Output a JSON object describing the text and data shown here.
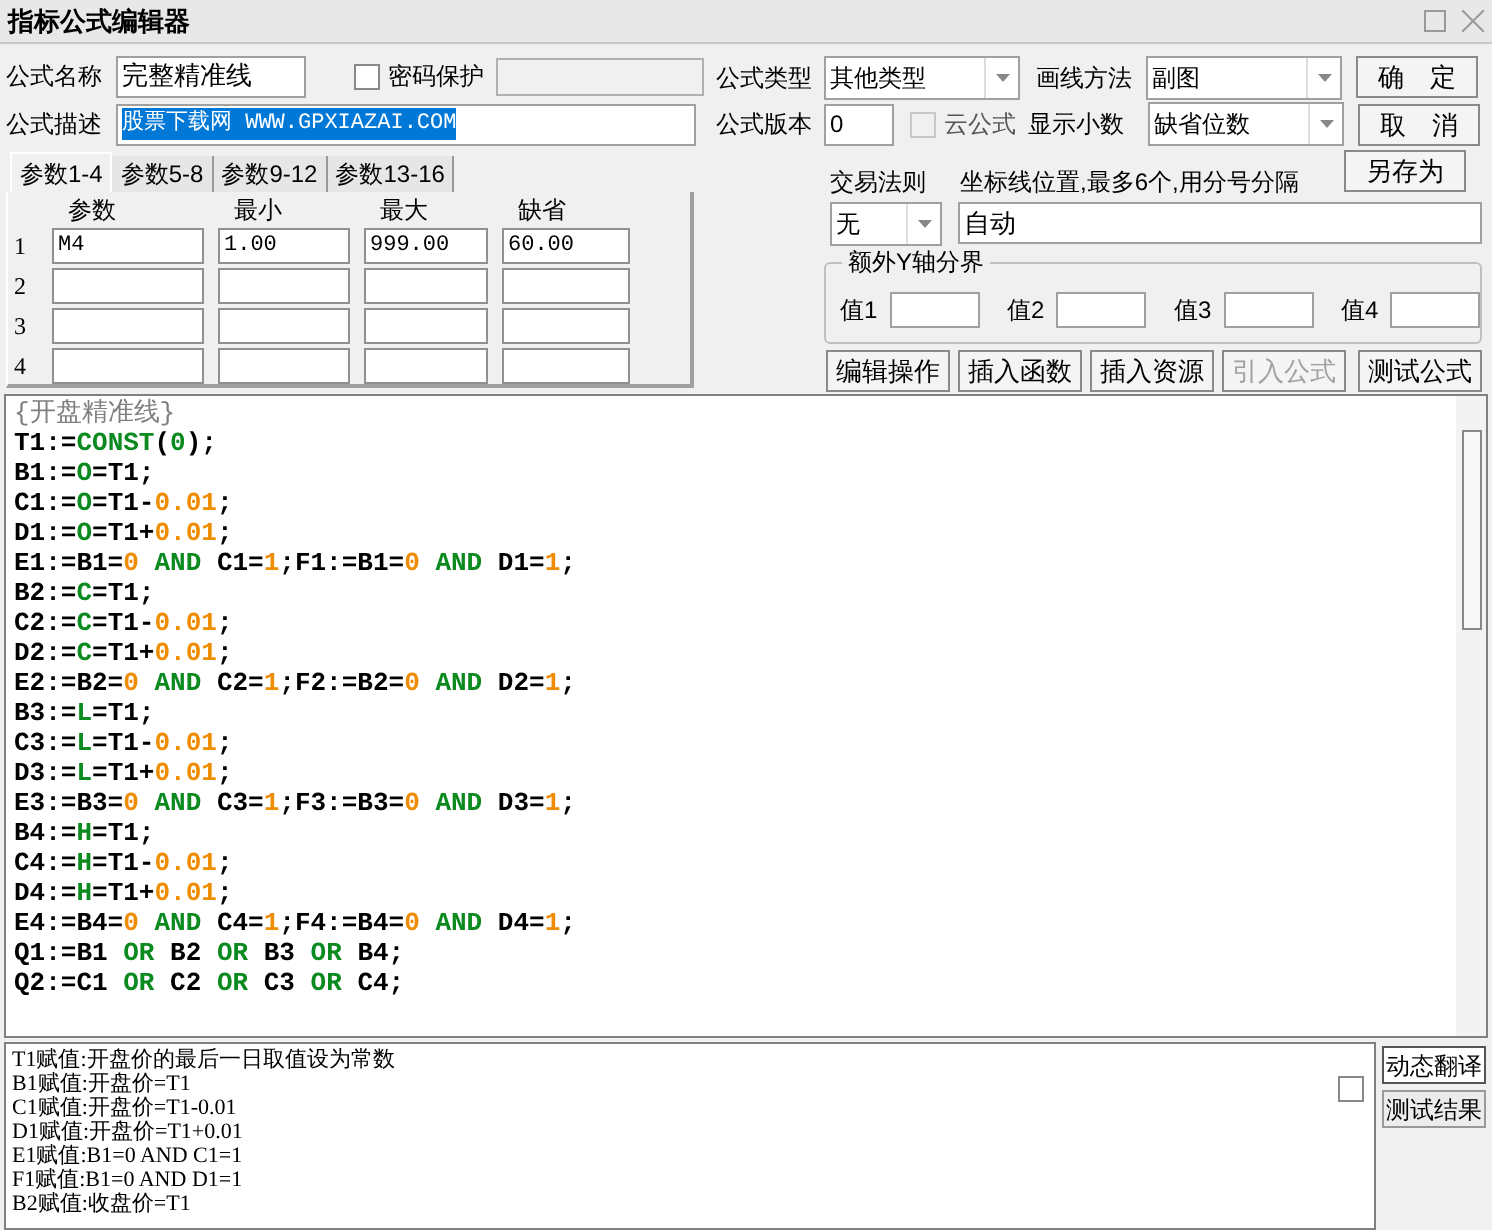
{
  "window": {
    "title": "指标公式编辑器"
  },
  "name_row": {
    "label": "公式名称",
    "value": "完整精准线",
    "password": {
      "label": "密码保护",
      "checked": false
    }
  },
  "desc_row": {
    "label": "公式描述",
    "value": "股票下载网 WWW.GPXIAZAI.COM",
    "text_selected": true
  },
  "param_tabs": [
    {
      "label": "参数1-4",
      "selected": true
    },
    {
      "label": "参数5-8",
      "selected": false
    },
    {
      "label": "参数9-12",
      "selected": false
    },
    {
      "label": "参数13-16",
      "selected": false
    }
  ],
  "param_table": {
    "columns": [
      "参数",
      "最小",
      "最大",
      "缺省"
    ],
    "rows": [
      {
        "index": "1",
        "cells": [
          "M4",
          "1.00",
          "999.00",
          "60.00"
        ]
      },
      {
        "index": "2",
        "cells": []
      },
      {
        "index": "3",
        "cells": []
      },
      {
        "index": "4",
        "cells": []
      }
    ]
  },
  "formula_type": {
    "label": "公式类型",
    "value": "其他类型"
  },
  "draw_method": {
    "label": "画线方法",
    "value": "副图"
  },
  "version": {
    "label": "公式版本",
    "value": "0"
  },
  "cloud": {
    "label": "云公式",
    "checked": false,
    "disabled": true
  },
  "decimals": {
    "label": "显示小数",
    "value": "缺省位数"
  },
  "trade_rule": {
    "label": "交易法则",
    "value": "无"
  },
  "axis_lines": {
    "label": "坐标线位置,最多6个,用分号分隔",
    "value": "自动"
  },
  "y_axis_group": {
    "title": "额外Y轴分界",
    "fields": [
      {
        "label": "值1"
      },
      {
        "label": "值2"
      },
      {
        "label": "值3"
      },
      {
        "label": "值4"
      }
    ]
  },
  "side_buttons": [
    {
      "label": "确　定"
    },
    {
      "label": "取　消"
    },
    {
      "label": "另存为"
    }
  ],
  "action_buttons": [
    {
      "label": "编辑操作",
      "disabled": false
    },
    {
      "label": "插入函数",
      "disabled": false
    },
    {
      "label": "插入资源",
      "disabled": false
    },
    {
      "label": "引入公式",
      "disabled": true
    },
    {
      "label": "测试公式",
      "disabled": false
    }
  ],
  "code_lines": [
    [
      {
        "kind": "comment",
        "text": "{开盘精准线}"
      }
    ],
    [
      {
        "kind": "plain",
        "text": "T1:="
      },
      {
        "kind": "function",
        "text": "CONST"
      },
      {
        "kind": "plain",
        "text": "("
      },
      {
        "kind": "function",
        "text": "0"
      },
      {
        "kind": "plain",
        "text": ");"
      }
    ],
    [
      {
        "kind": "plain",
        "text": "B1:="
      },
      {
        "kind": "function",
        "text": "O"
      },
      {
        "kind": "plain",
        "text": "=T1;"
      }
    ],
    [
      {
        "kind": "plain",
        "text": "C1:="
      },
      {
        "kind": "function",
        "text": "O"
      },
      {
        "kind": "plain",
        "text": "=T1-"
      },
      {
        "kind": "number",
        "text": "0.01"
      },
      {
        "kind": "plain",
        "text": ";"
      }
    ],
    [
      {
        "kind": "plain",
        "text": "D1:="
      },
      {
        "kind": "function",
        "text": "O"
      },
      {
        "kind": "plain",
        "text": "=T1+"
      },
      {
        "kind": "number",
        "text": "0.01"
      },
      {
        "kind": "plain",
        "text": ";"
      }
    ],
    [
      {
        "kind": "plain",
        "text": "E1:=B1="
      },
      {
        "kind": "number",
        "text": "0"
      },
      {
        "kind": "keyword",
        "text": " AND "
      },
      {
        "kind": "plain",
        "text": "C1="
      },
      {
        "kind": "number",
        "text": "1"
      },
      {
        "kind": "plain",
        "text": ";F1:=B1="
      },
      {
        "kind": "number",
        "text": "0"
      },
      {
        "kind": "keyword",
        "text": " AND "
      },
      {
        "kind": "plain",
        "text": "D1="
      },
      {
        "kind": "number",
        "text": "1"
      },
      {
        "kind": "plain",
        "text": ";"
      }
    ],
    [
      {
        "kind": "plain",
        "text": "B2:="
      },
      {
        "kind": "function",
        "text": "C"
      },
      {
        "kind": "plain",
        "text": "=T1;"
      }
    ],
    [
      {
        "kind": "plain",
        "text": "C2:="
      },
      {
        "kind": "function",
        "text": "C"
      },
      {
        "kind": "plain",
        "text": "=T1-"
      },
      {
        "kind": "number",
        "text": "0.01"
      },
      {
        "kind": "plain",
        "text": ";"
      }
    ],
    [
      {
        "kind": "plain",
        "text": "D2:="
      },
      {
        "kind": "function",
        "text": "C"
      },
      {
        "kind": "plain",
        "text": "=T1+"
      },
      {
        "kind": "number",
        "text": "0.01"
      },
      {
        "kind": "plain",
        "text": ";"
      }
    ],
    [
      {
        "kind": "plain",
        "text": "E2:=B2="
      },
      {
        "kind": "number",
        "text": "0"
      },
      {
        "kind": "keyword",
        "text": " AND "
      },
      {
        "kind": "plain",
        "text": "C2="
      },
      {
        "kind": "number",
        "text": "1"
      },
      {
        "kind": "plain",
        "text": ";F2:=B2="
      },
      {
        "kind": "number",
        "text": "0"
      },
      {
        "kind": "keyword",
        "text": " AND "
      },
      {
        "kind": "plain",
        "text": "D2="
      },
      {
        "kind": "number",
        "text": "1"
      },
      {
        "kind": "plain",
        "text": ";"
      }
    ],
    [
      {
        "kind": "plain",
        "text": "B3:="
      },
      {
        "kind": "function",
        "text": "L"
      },
      {
        "kind": "plain",
        "text": "=T1;"
      }
    ],
    [
      {
        "kind": "plain",
        "text": "C3:="
      },
      {
        "kind": "function",
        "text": "L"
      },
      {
        "kind": "plain",
        "text": "=T1-"
      },
      {
        "kind": "number",
        "text": "0.01"
      },
      {
        "kind": "plain",
        "text": ";"
      }
    ],
    [
      {
        "kind": "plain",
        "text": "D3:="
      },
      {
        "kind": "function",
        "text": "L"
      },
      {
        "kind": "plain",
        "text": "=T1+"
      },
      {
        "kind": "number",
        "text": "0.01"
      },
      {
        "kind": "plain",
        "text": ";"
      }
    ],
    [
      {
        "kind": "plain",
        "text": "E3:=B3="
      },
      {
        "kind": "number",
        "text": "0"
      },
      {
        "kind": "keyword",
        "text": " AND "
      },
      {
        "kind": "plain",
        "text": "C3="
      },
      {
        "kind": "number",
        "text": "1"
      },
      {
        "kind": "plain",
        "text": ";F3:=B3="
      },
      {
        "kind": "number",
        "text": "0"
      },
      {
        "kind": "keyword",
        "text": " AND "
      },
      {
        "kind": "plain",
        "text": "D3="
      },
      {
        "kind": "number",
        "text": "1"
      },
      {
        "kind": "plain",
        "text": ";"
      }
    ],
    [
      {
        "kind": "plain",
        "text": "B4:="
      },
      {
        "kind": "function",
        "text": "H"
      },
      {
        "kind": "plain",
        "text": "=T1;"
      }
    ],
    [
      {
        "kind": "plain",
        "text": "C4:="
      },
      {
        "kind": "function",
        "text": "H"
      },
      {
        "kind": "plain",
        "text": "=T1-"
      },
      {
        "kind": "number",
        "text": "0.01"
      },
      {
        "kind": "plain",
        "text": ";"
      }
    ],
    [
      {
        "kind": "plain",
        "text": "D4:="
      },
      {
        "kind": "function",
        "text": "H"
      },
      {
        "kind": "plain",
        "text": "=T1+"
      },
      {
        "kind": "number",
        "text": "0.01"
      },
      {
        "kind": "plain",
        "text": ";"
      }
    ],
    [
      {
        "kind": "plain",
        "text": "E4:=B4="
      },
      {
        "kind": "number",
        "text": "0"
      },
      {
        "kind": "keyword",
        "text": " AND "
      },
      {
        "kind": "plain",
        "text": "C4="
      },
      {
        "kind": "number",
        "text": "1"
      },
      {
        "kind": "plain",
        "text": ";F4:=B4="
      },
      {
        "kind": "number",
        "text": "0"
      },
      {
        "kind": "keyword",
        "text": " AND "
      },
      {
        "kind": "plain",
        "text": "D4="
      },
      {
        "kind": "number",
        "text": "1"
      },
      {
        "kind": "plain",
        "text": ";"
      }
    ],
    [
      {
        "kind": "plain",
        "text": "Q1:=B1"
      },
      {
        "kind": "keyword",
        "text": " OR "
      },
      {
        "kind": "plain",
        "text": "B2"
      },
      {
        "kind": "keyword",
        "text": " OR "
      },
      {
        "kind": "plain",
        "text": "B3"
      },
      {
        "kind": "keyword",
        "text": " OR "
      },
      {
        "kind": "plain",
        "text": "B4;"
      }
    ],
    [
      {
        "kind": "plain",
        "text": "Q2:=C1"
      },
      {
        "kind": "keyword",
        "text": " OR "
      },
      {
        "kind": "plain",
        "text": "C2"
      },
      {
        "kind": "keyword",
        "text": " OR "
      },
      {
        "kind": "plain",
        "text": "C3"
      },
      {
        "kind": "keyword",
        "text": " OR "
      },
      {
        "kind": "plain",
        "text": "C4;"
      }
    ]
  ],
  "help_lines": [
    "T1赋值:开盘价的最后一日取值设为常数",
    "B1赋值:开盘价=T1",
    "C1赋值:开盘价=T1-0.01",
    "D1赋值:开盘价=T1+0.01",
    "E1赋值:B1=0 AND C1=1",
    "F1赋值:B1=0 AND D1=1",
    "B2赋值:收盘价=T1"
  ],
  "help_checkbox": {
    "checked": false
  },
  "result_tabs": [
    {
      "label": "动态翻译",
      "selected": true
    },
    {
      "label": "测试结果",
      "selected": false
    }
  ]
}
